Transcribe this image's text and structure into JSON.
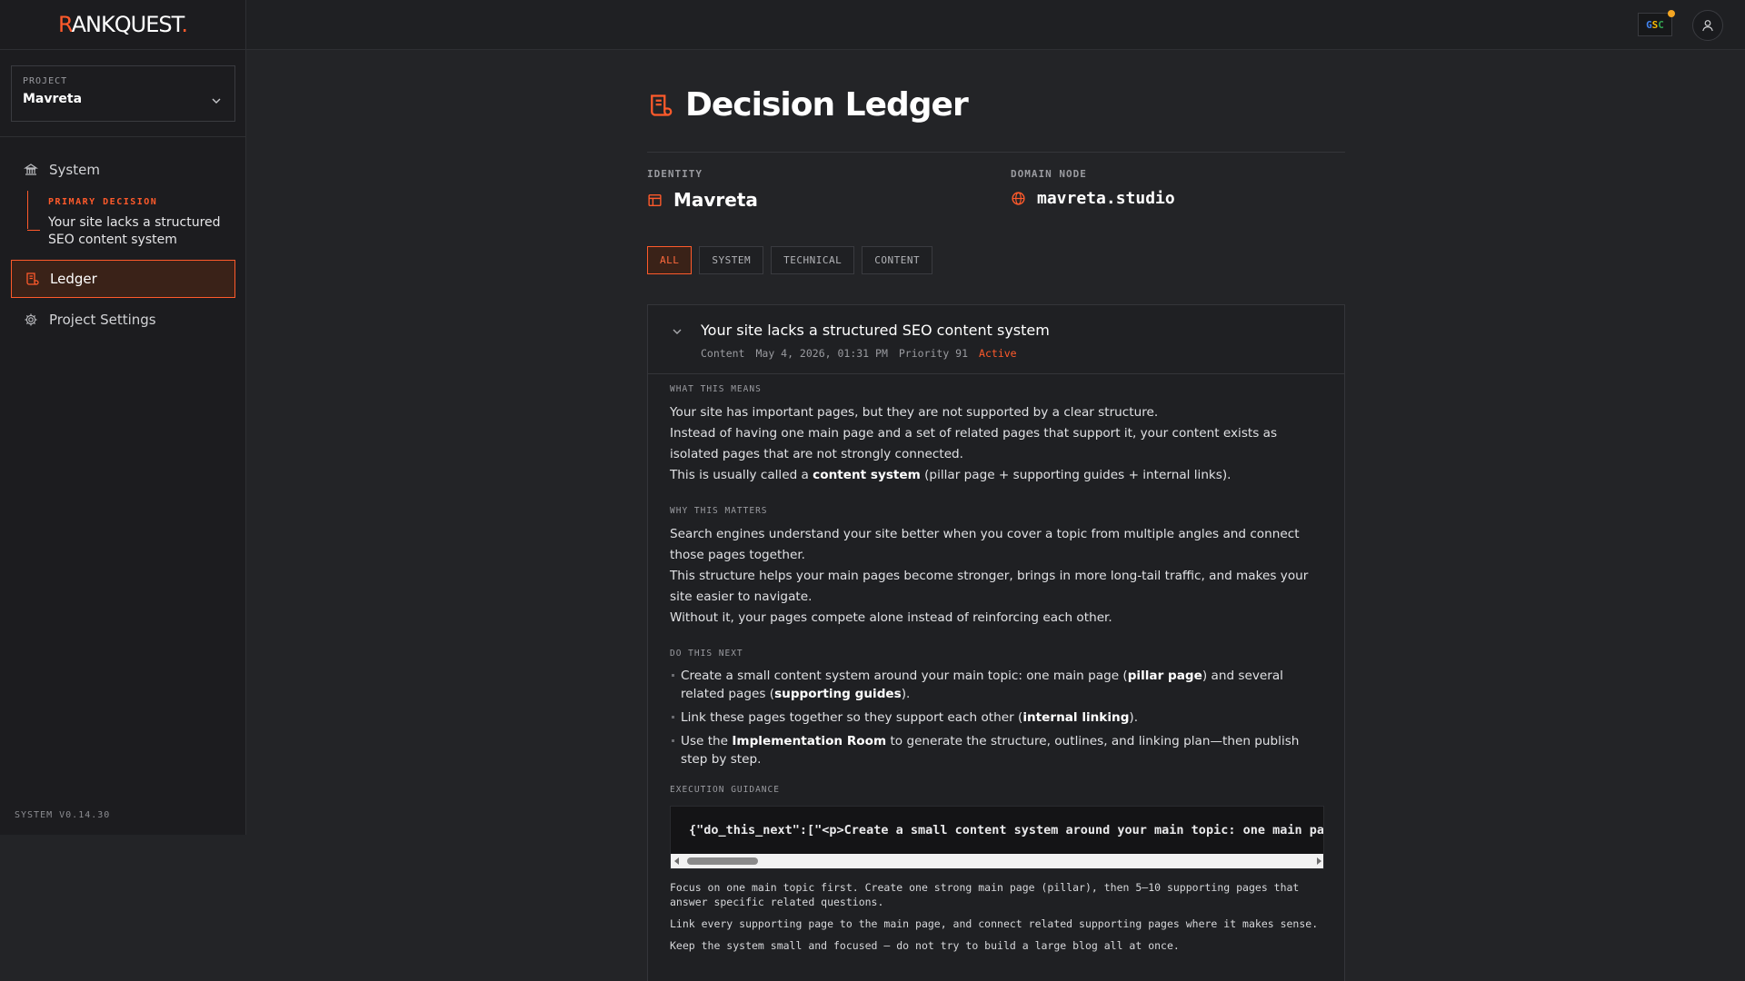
{
  "brand": {
    "first": "R",
    "rest": "ANKQUEST",
    "dot": "."
  },
  "sidebar": {
    "project_label": "PROJECT",
    "project_value": "Mavreta",
    "nav": {
      "system": "System",
      "ledger": "Ledger",
      "settings": "Project Settings"
    },
    "primary_decision_label": "PRIMARY DECISION",
    "primary_decision_text": "Your site lacks a structured SEO content system",
    "version": "SYSTEM V0.14.30"
  },
  "topbar": {
    "gsc_label": "GSC"
  },
  "page": {
    "title": "Decision Ledger",
    "identity_label": "IDENTITY",
    "identity_value": "Mavreta",
    "domain_label": "DOMAIN NODE",
    "domain_value": "mavreta.studio",
    "filters": [
      "ALL",
      "SYSTEM",
      "TECHNICAL",
      "CONTENT"
    ]
  },
  "decision": {
    "title": "Your site lacks a structured SEO content system",
    "category": "Content",
    "date": "May 4, 2026, 01:31 PM",
    "priority": "Priority 91",
    "status": "Active",
    "what_label": "WHAT THIS MEANS",
    "what_1": "Your site has important pages, but they are not supported by a clear structure.",
    "what_2": "Instead of having one main page and a set of related pages that support it, your content exists as isolated pages that are not strongly connected.",
    "what_3_pre": "This is usually called a ",
    "what_3_bold": "content system",
    "what_3_post": " (pillar page + supporting guides + internal links).",
    "why_label": "WHY THIS MATTERS",
    "why_1": "Search engines understand your site better when you cover a topic from multiple angles and connect those pages together.",
    "why_2": "This structure helps your main pages become stronger, brings in more long-tail traffic, and makes your site easier to navigate.",
    "why_3": "Without it, your pages compete alone instead of reinforcing each other.",
    "next_label": "DO THIS NEXT",
    "next_1_a": "Create a small content system around your main topic: one main page (",
    "next_1_b": "pillar page",
    "next_1_c": ") and several related pages (",
    "next_1_d": "supporting guides",
    "next_1_e": ").",
    "next_2_a": "Link these pages together so they support each other (",
    "next_2_b": "internal linking",
    "next_2_c": ").",
    "next_3_a": "Use the ",
    "next_3_b": "Implementation Room",
    "next_3_c": " to generate the structure, outlines, and linking plan—then publish step by step.",
    "exec_label": "EXECUTION GUIDANCE",
    "exec_code": "{\"do_this_next\":[\"<p>Create a small content system around your main topic: one main page (<strong>pillar page</strong>)",
    "guide_1": "Focus on one main topic first. Create one strong main page (pillar), then 5–10 supporting pages that answer specific related questions.",
    "guide_2": "Link every supporting page to the main page, and connect related supporting pages where it makes sense.",
    "guide_3": "Keep the system small and focused — do not try to build a large blog all at once."
  },
  "colors": {
    "accent": "#ff5a2b",
    "bg": "#232427",
    "sidebar": "#1c1c1f"
  },
  "icons": [
    "scroll-icon",
    "bank-icon",
    "gear-icon",
    "chevron-down-icon",
    "user-icon",
    "building-icon",
    "globe-icon"
  ]
}
